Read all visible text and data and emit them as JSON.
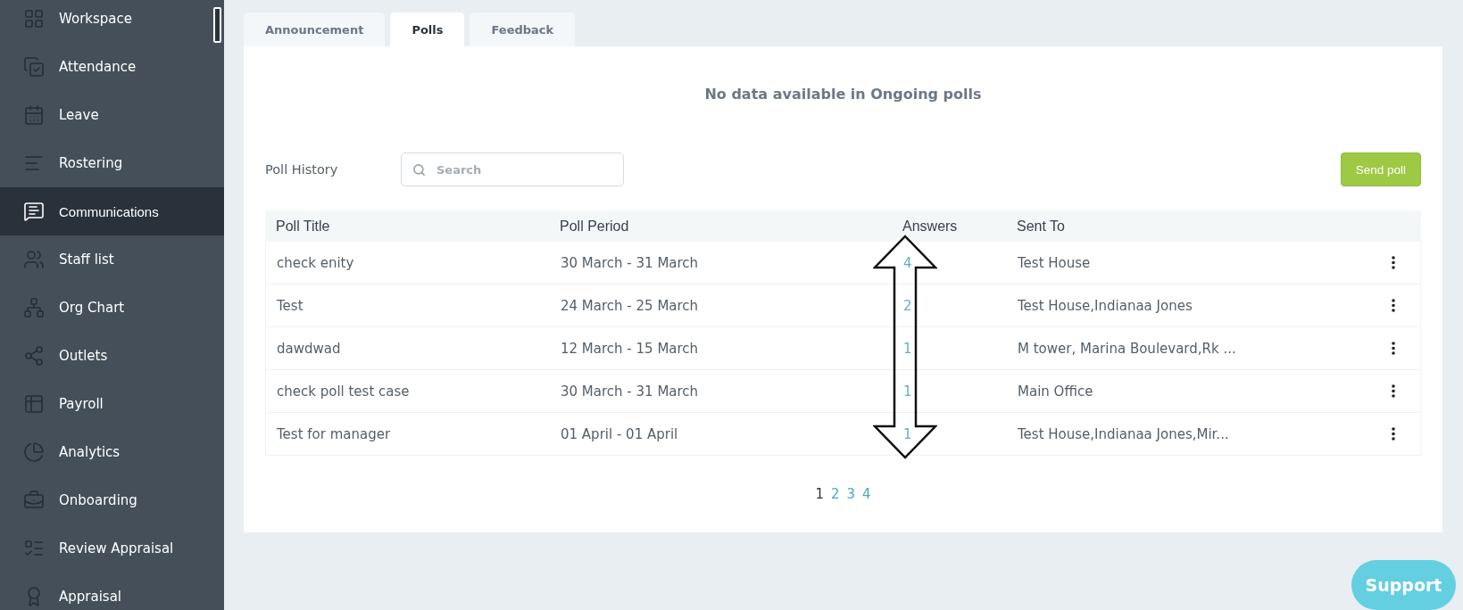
{
  "sidebar": {
    "items": [
      {
        "label": "Workspace",
        "selected": false
      },
      {
        "label": "Attendance",
        "selected": false
      },
      {
        "label": "Leave",
        "selected": false
      },
      {
        "label": "Rostering",
        "selected": false
      },
      {
        "label": "Communications",
        "selected": true
      },
      {
        "label": "Staff list",
        "selected": false
      },
      {
        "label": "Org Chart",
        "selected": false
      },
      {
        "label": "Outlets",
        "selected": false
      },
      {
        "label": "Payroll",
        "selected": false
      },
      {
        "label": "Analytics",
        "selected": false
      },
      {
        "label": "Onboarding",
        "selected": false
      },
      {
        "label": "Review Appraisal",
        "selected": false
      },
      {
        "label": "Appraisal",
        "selected": false
      }
    ]
  },
  "tabs": [
    {
      "label": "Announcement",
      "selected": false
    },
    {
      "label": "Polls",
      "selected": true
    },
    {
      "label": "Feedback",
      "selected": false
    }
  ],
  "ongoing_message": "No data available in Ongoing polls",
  "poll_history": {
    "label": "Poll History",
    "search": {
      "placeholder": "Search"
    },
    "send_button": "Send poll"
  },
  "table": {
    "columns": [
      "Poll Title",
      "Poll Period",
      "Answers",
      "Sent To"
    ],
    "rows": [
      {
        "title": "check enity",
        "period": "30 March - 31 March",
        "answers": "4",
        "sent_to": "Test House"
      },
      {
        "title": "Test",
        "period": "24 March - 25 March",
        "answers": "2",
        "sent_to": "Test House,Indianaa Jones"
      },
      {
        "title": "dawdwad",
        "period": "12 March - 15 March",
        "answers": "1",
        "sent_to": "M tower, Marina Boulevard,Rk ..."
      },
      {
        "title": "check poll test case",
        "period": "30 March - 31 March",
        "answers": "1",
        "sent_to": "Main Office"
      },
      {
        "title": "Test for manager",
        "period": "01 April - 01 April",
        "answers": "1",
        "sent_to": "Test House,Indianaa Jones,Mir..."
      }
    ]
  },
  "pagination": [
    {
      "label": "1",
      "selected": true
    },
    {
      "label": "2",
      "selected": false
    },
    {
      "label": "3",
      "selected": false
    },
    {
      "label": "4",
      "selected": false
    }
  ],
  "support_button": "Support"
}
